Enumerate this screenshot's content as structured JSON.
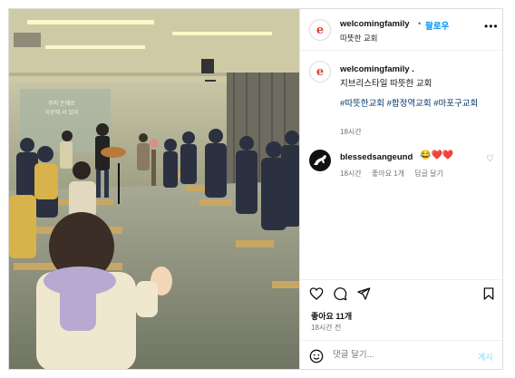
{
  "post": {
    "username": "welcomingfamily",
    "dot": "•",
    "follow_label": "팔로우",
    "location": "따뜻한 교회",
    "more_icon": "more-horizontal-icon",
    "avatar_letter": "e"
  },
  "image": {
    "wall_text_line1": "주의 은혜로",
    "wall_text_line2": "이곳에 서 있어"
  },
  "caption": {
    "username": "welcomingfamily .",
    "text": "지브리스타일 따뜻한 교회",
    "hashtags": "#따뜻한교회 #합정역교회 #마포구교회",
    "time": "18시간"
  },
  "comments": [
    {
      "username": "blessedsangeund",
      "emojis": "😂❤️❤️",
      "time": "18시간",
      "likes": "좋아요 1개",
      "reply_label": "답글 달기"
    }
  ],
  "actions": {
    "icons": [
      "heart-icon",
      "comment-icon",
      "share-icon",
      "bookmark-icon"
    ]
  },
  "likes_text": "좋아요 11개",
  "post_time": "18시간 전",
  "comment_input": {
    "placeholder": "댓글 달기...",
    "post_label": "게시"
  },
  "colors": {
    "link_blue": "#0095f6",
    "hashtag": "#00376b",
    "muted": "#737373",
    "heart_red": "#e0245e"
  }
}
